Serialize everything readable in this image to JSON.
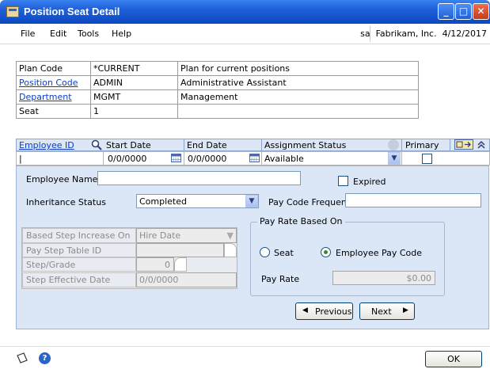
{
  "window": {
    "title": "Position Seat Detail"
  },
  "menu": {
    "items": [
      "File",
      "Edit",
      "Tools",
      "Help"
    ],
    "company": "sa  Fabrikam, Inc.  4/12/2017"
  },
  "info": {
    "rows": [
      {
        "label": "Plan Code",
        "value": "*CURRENT",
        "desc": "Plan for current positions"
      },
      {
        "label": "Position Code",
        "value": "ADMIN",
        "desc": "Administrative Assistant"
      },
      {
        "label": "Department",
        "value": "MGMT",
        "desc": "Management"
      },
      {
        "label": "Seat",
        "value": "1",
        "desc": ""
      }
    ]
  },
  "grid": {
    "headers": {
      "employee_id": "Employee ID",
      "start": "Start Date",
      "end": "End Date",
      "status": "Assignment Status",
      "primary": "Primary"
    },
    "row": {
      "employee_id": "|",
      "start": "0/0/0000",
      "end": "0/0/0000",
      "status": "Available"
    }
  },
  "form": {
    "employee_name_label": "Employee Name",
    "employee_name": "",
    "expired_label": "Expired",
    "inheritance_label": "Inheritance Status",
    "inheritance_value": "Completed",
    "pay_code_freq_label": "Pay Code Frequency",
    "pay_code_freq": "",
    "based_step_label": "Based Step Increase On",
    "based_step_value": "Hire Date",
    "pay_step_table_label": "Pay Step Table ID",
    "pay_step_table_value": "",
    "step_grade_label": "Step/Grade",
    "step_grade_value": "0",
    "step_effective_label": "Step Effective Date",
    "step_effective_value": "0/0/0000",
    "pay_rate_group_label": "Pay Rate Based On",
    "seat_label": "Seat",
    "employee_pay_code_label": "Employee Pay Code",
    "pay_rate_label": "Pay Rate",
    "pay_rate_value": "$0.00"
  },
  "buttons": {
    "previous": "Previous",
    "next": "Next",
    "ok": "OK"
  }
}
